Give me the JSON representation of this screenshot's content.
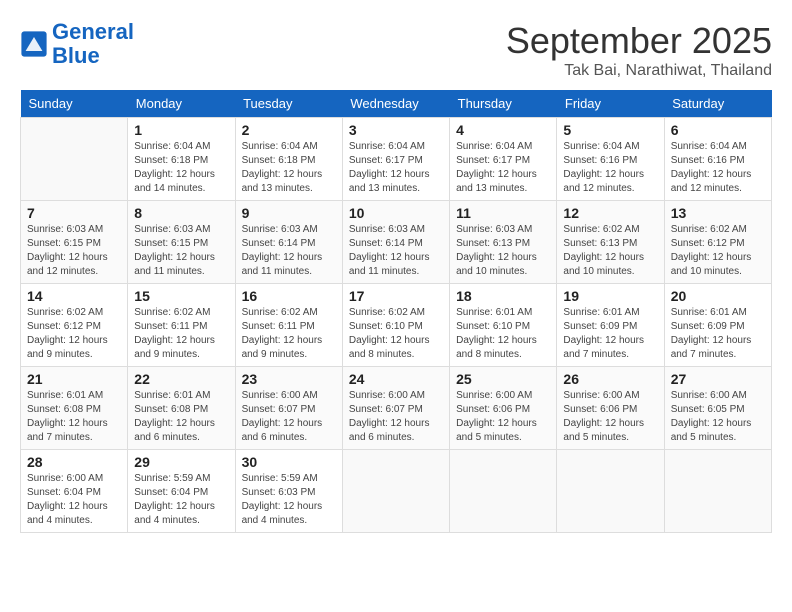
{
  "logo": {
    "line1": "General",
    "line2": "Blue"
  },
  "title": "September 2025",
  "location": "Tak Bai, Narathiwat, Thailand",
  "days_of_week": [
    "Sunday",
    "Monday",
    "Tuesday",
    "Wednesday",
    "Thursday",
    "Friday",
    "Saturday"
  ],
  "weeks": [
    [
      {
        "day": "",
        "sunrise": "",
        "sunset": "",
        "daylight": ""
      },
      {
        "day": "1",
        "sunrise": "Sunrise: 6:04 AM",
        "sunset": "Sunset: 6:18 PM",
        "daylight": "Daylight: 12 hours and 14 minutes."
      },
      {
        "day": "2",
        "sunrise": "Sunrise: 6:04 AM",
        "sunset": "Sunset: 6:18 PM",
        "daylight": "Daylight: 12 hours and 13 minutes."
      },
      {
        "day": "3",
        "sunrise": "Sunrise: 6:04 AM",
        "sunset": "Sunset: 6:17 PM",
        "daylight": "Daylight: 12 hours and 13 minutes."
      },
      {
        "day": "4",
        "sunrise": "Sunrise: 6:04 AM",
        "sunset": "Sunset: 6:17 PM",
        "daylight": "Daylight: 12 hours and 13 minutes."
      },
      {
        "day": "5",
        "sunrise": "Sunrise: 6:04 AM",
        "sunset": "Sunset: 6:16 PM",
        "daylight": "Daylight: 12 hours and 12 minutes."
      },
      {
        "day": "6",
        "sunrise": "Sunrise: 6:04 AM",
        "sunset": "Sunset: 6:16 PM",
        "daylight": "Daylight: 12 hours and 12 minutes."
      }
    ],
    [
      {
        "day": "7",
        "sunrise": "Sunrise: 6:03 AM",
        "sunset": "Sunset: 6:15 PM",
        "daylight": "Daylight: 12 hours and 12 minutes."
      },
      {
        "day": "8",
        "sunrise": "Sunrise: 6:03 AM",
        "sunset": "Sunset: 6:15 PM",
        "daylight": "Daylight: 12 hours and 11 minutes."
      },
      {
        "day": "9",
        "sunrise": "Sunrise: 6:03 AM",
        "sunset": "Sunset: 6:14 PM",
        "daylight": "Daylight: 12 hours and 11 minutes."
      },
      {
        "day": "10",
        "sunrise": "Sunrise: 6:03 AM",
        "sunset": "Sunset: 6:14 PM",
        "daylight": "Daylight: 12 hours and 11 minutes."
      },
      {
        "day": "11",
        "sunrise": "Sunrise: 6:03 AM",
        "sunset": "Sunset: 6:13 PM",
        "daylight": "Daylight: 12 hours and 10 minutes."
      },
      {
        "day": "12",
        "sunrise": "Sunrise: 6:02 AM",
        "sunset": "Sunset: 6:13 PM",
        "daylight": "Daylight: 12 hours and 10 minutes."
      },
      {
        "day": "13",
        "sunrise": "Sunrise: 6:02 AM",
        "sunset": "Sunset: 6:12 PM",
        "daylight": "Daylight: 12 hours and 10 minutes."
      }
    ],
    [
      {
        "day": "14",
        "sunrise": "Sunrise: 6:02 AM",
        "sunset": "Sunset: 6:12 PM",
        "daylight": "Daylight: 12 hours and 9 minutes."
      },
      {
        "day": "15",
        "sunrise": "Sunrise: 6:02 AM",
        "sunset": "Sunset: 6:11 PM",
        "daylight": "Daylight: 12 hours and 9 minutes."
      },
      {
        "day": "16",
        "sunrise": "Sunrise: 6:02 AM",
        "sunset": "Sunset: 6:11 PM",
        "daylight": "Daylight: 12 hours and 9 minutes."
      },
      {
        "day": "17",
        "sunrise": "Sunrise: 6:02 AM",
        "sunset": "Sunset: 6:10 PM",
        "daylight": "Daylight: 12 hours and 8 minutes."
      },
      {
        "day": "18",
        "sunrise": "Sunrise: 6:01 AM",
        "sunset": "Sunset: 6:10 PM",
        "daylight": "Daylight: 12 hours and 8 minutes."
      },
      {
        "day": "19",
        "sunrise": "Sunrise: 6:01 AM",
        "sunset": "Sunset: 6:09 PM",
        "daylight": "Daylight: 12 hours and 7 minutes."
      },
      {
        "day": "20",
        "sunrise": "Sunrise: 6:01 AM",
        "sunset": "Sunset: 6:09 PM",
        "daylight": "Daylight: 12 hours and 7 minutes."
      }
    ],
    [
      {
        "day": "21",
        "sunrise": "Sunrise: 6:01 AM",
        "sunset": "Sunset: 6:08 PM",
        "daylight": "Daylight: 12 hours and 7 minutes."
      },
      {
        "day": "22",
        "sunrise": "Sunrise: 6:01 AM",
        "sunset": "Sunset: 6:08 PM",
        "daylight": "Daylight: 12 hours and 6 minutes."
      },
      {
        "day": "23",
        "sunrise": "Sunrise: 6:00 AM",
        "sunset": "Sunset: 6:07 PM",
        "daylight": "Daylight: 12 hours and 6 minutes."
      },
      {
        "day": "24",
        "sunrise": "Sunrise: 6:00 AM",
        "sunset": "Sunset: 6:07 PM",
        "daylight": "Daylight: 12 hours and 6 minutes."
      },
      {
        "day": "25",
        "sunrise": "Sunrise: 6:00 AM",
        "sunset": "Sunset: 6:06 PM",
        "daylight": "Daylight: 12 hours and 5 minutes."
      },
      {
        "day": "26",
        "sunrise": "Sunrise: 6:00 AM",
        "sunset": "Sunset: 6:06 PM",
        "daylight": "Daylight: 12 hours and 5 minutes."
      },
      {
        "day": "27",
        "sunrise": "Sunrise: 6:00 AM",
        "sunset": "Sunset: 6:05 PM",
        "daylight": "Daylight: 12 hours and 5 minutes."
      }
    ],
    [
      {
        "day": "28",
        "sunrise": "Sunrise: 6:00 AM",
        "sunset": "Sunset: 6:04 PM",
        "daylight": "Daylight: 12 hours and 4 minutes."
      },
      {
        "day": "29",
        "sunrise": "Sunrise: 5:59 AM",
        "sunset": "Sunset: 6:04 PM",
        "daylight": "Daylight: 12 hours and 4 minutes."
      },
      {
        "day": "30",
        "sunrise": "Sunrise: 5:59 AM",
        "sunset": "Sunset: 6:03 PM",
        "daylight": "Daylight: 12 hours and 4 minutes."
      },
      {
        "day": "",
        "sunrise": "",
        "sunset": "",
        "daylight": ""
      },
      {
        "day": "",
        "sunrise": "",
        "sunset": "",
        "daylight": ""
      },
      {
        "day": "",
        "sunrise": "",
        "sunset": "",
        "daylight": ""
      },
      {
        "day": "",
        "sunrise": "",
        "sunset": "",
        "daylight": ""
      }
    ]
  ]
}
